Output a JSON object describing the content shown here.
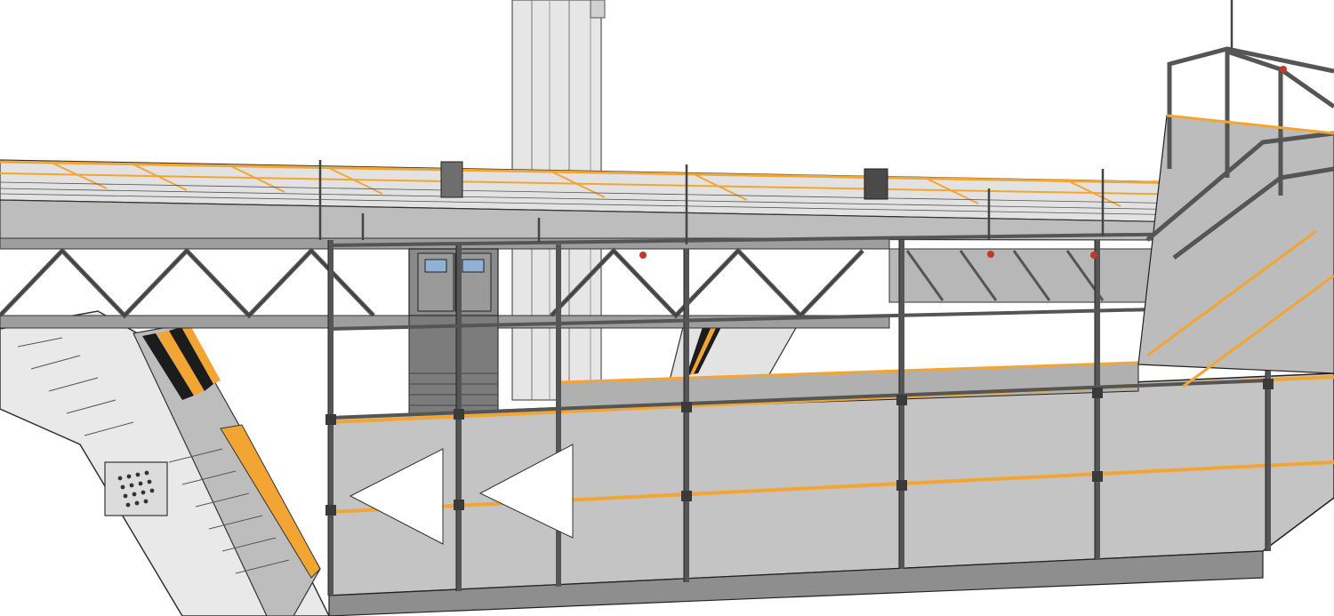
{
  "scene": {
    "description_visible_text": "",
    "palette": {
      "background": "#ffffff",
      "panel": "#c9c9c9",
      "panel_dark": "#a9a9a9",
      "frame": "#6e6e6e",
      "frame_dark": "#3a3a3a",
      "outline": "#222222",
      "accent_orange": "#f3a533",
      "hazard_black": "#1c1c1c",
      "tower": "#e4e4e4",
      "glass": "#8fb2d6",
      "signal_red": "#c0392b"
    },
    "elements": {
      "tower": "concrete-tower",
      "deck": "upper-walkway-deck",
      "truss": "steel-truss-girder",
      "gantry": "scaffold-gantry",
      "arrows": "direction-arrow-pair",
      "ramp": "diagonal-ramp-structure",
      "doors": "double-door-with-windows",
      "railing": "stair-railing"
    }
  }
}
